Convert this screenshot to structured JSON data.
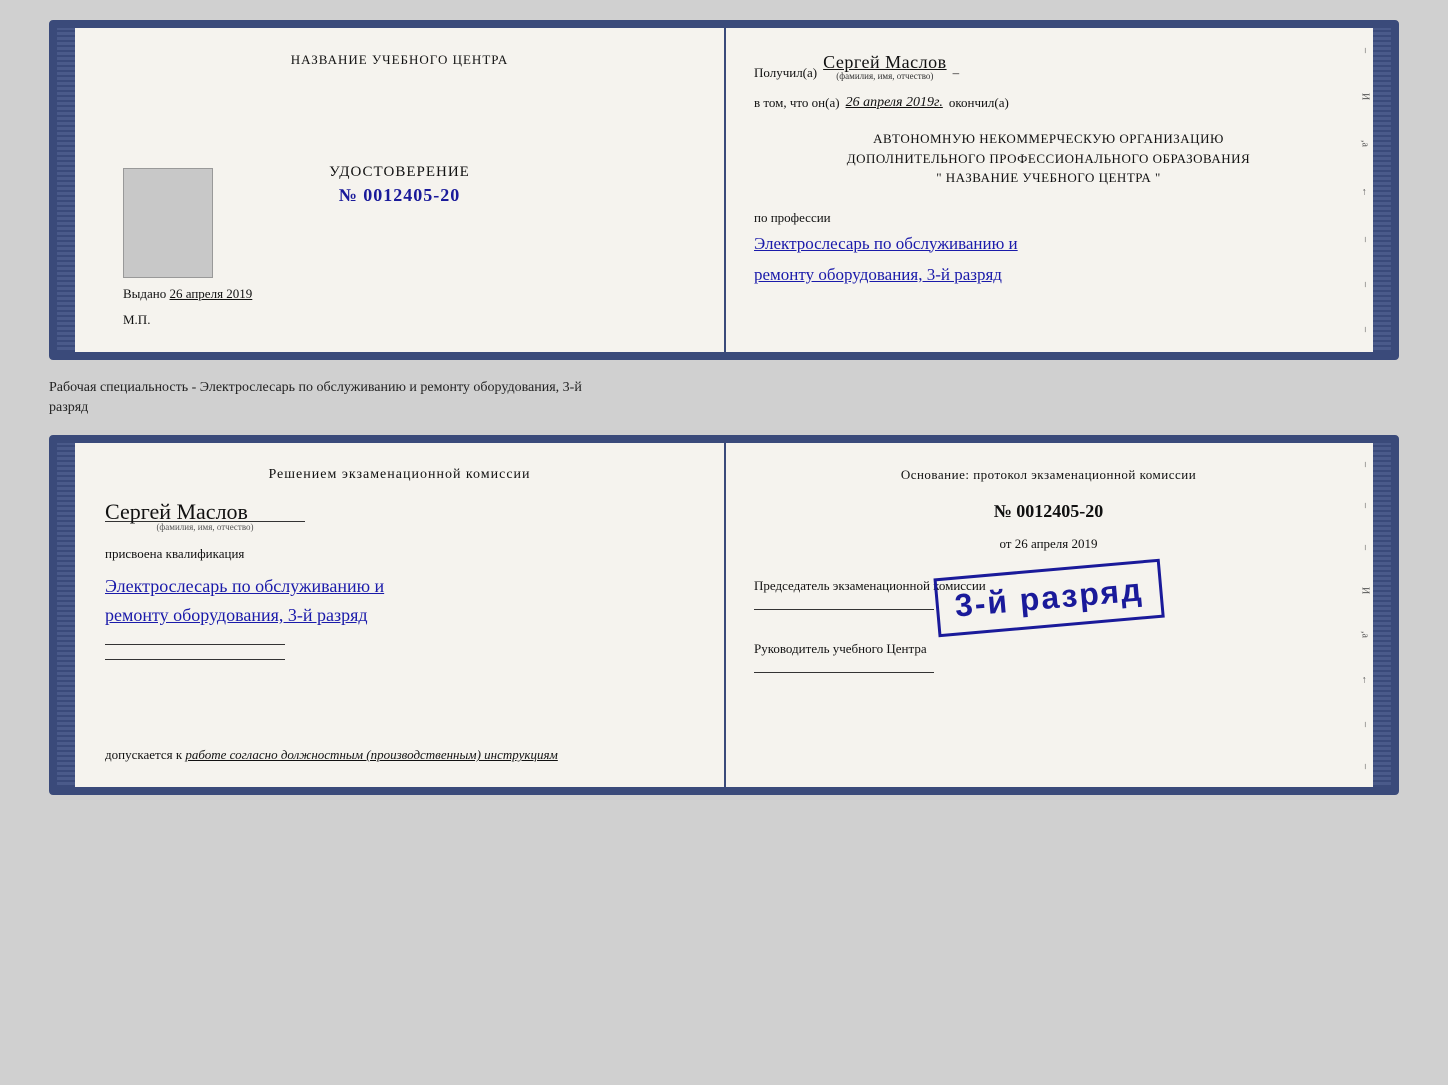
{
  "doc1": {
    "left": {
      "center_title": "НАЗВАНИЕ УЧЕБНОГО ЦЕНТРА",
      "udostoverenie_label": "УДОСТОВЕРЕНИЕ",
      "number": "№ 0012405-20",
      "vydano_label": "Выдано",
      "vydano_date": "26 апреля 2019",
      "mp_label": "М.П."
    },
    "right": {
      "poluchil_label": "Получил(а)",
      "poluchil_name": "Сергей Маслов",
      "poluchil_subtitle": "(фамилия, имя, отчество)",
      "dash": "–",
      "v_tom_label": "в том, что он(а)",
      "v_tom_date": "26 апреля 2019г.",
      "okonchil_label": "окончил(а)",
      "org_line1": "АВТОНОМНУЮ НЕКОММЕРЧЕСКУЮ ОРГАНИЗАЦИЮ",
      "org_line2": "ДОПОЛНИТЕЛЬНОГО ПРОФЕССИОНАЛЬНОГО ОБРАЗОВАНИЯ",
      "org_name": "\" НАЗВАНИЕ УЧЕБНОГО ЦЕНТРА \"",
      "po_professii_label": "по профессии",
      "profession_line1": "Электрослесарь по обслуживанию и",
      "profession_line2": "ремонту оборудования, 3-й разряд"
    }
  },
  "label_between": {
    "line1": "Рабочая специальность - Электрослесарь по обслуживанию и ремонту оборудования, 3-й",
    "line2": "разряд"
  },
  "doc2": {
    "left": {
      "resheniyem_label": "Решением экзаменационной комиссии",
      "fio_name": "Сергей Маслов",
      "fio_subtitle": "(фамилия, имя, отчество)",
      "prisvoena_label": "присвоена квалификация",
      "qualification_line1": "Электрослесарь по обслуживанию и",
      "qualification_line2": "ремонту оборудования, 3-й разряд",
      "dopuskaetsya_label": "допускается к",
      "dopuskaetsya_value": "работе согласно должностным (производственным) инструкциям"
    },
    "right": {
      "osnovanie_label": "Основание: протокол экзаменационной комиссии",
      "number": "№  0012405-20",
      "ot_label": "от",
      "ot_date": "26 апреля 2019",
      "predsedatel_label": "Председатель экзаменационной комиссии",
      "rukovoditel_label": "Руководитель учебного Центра"
    },
    "stamp": {
      "text": "3-й разряд"
    }
  }
}
